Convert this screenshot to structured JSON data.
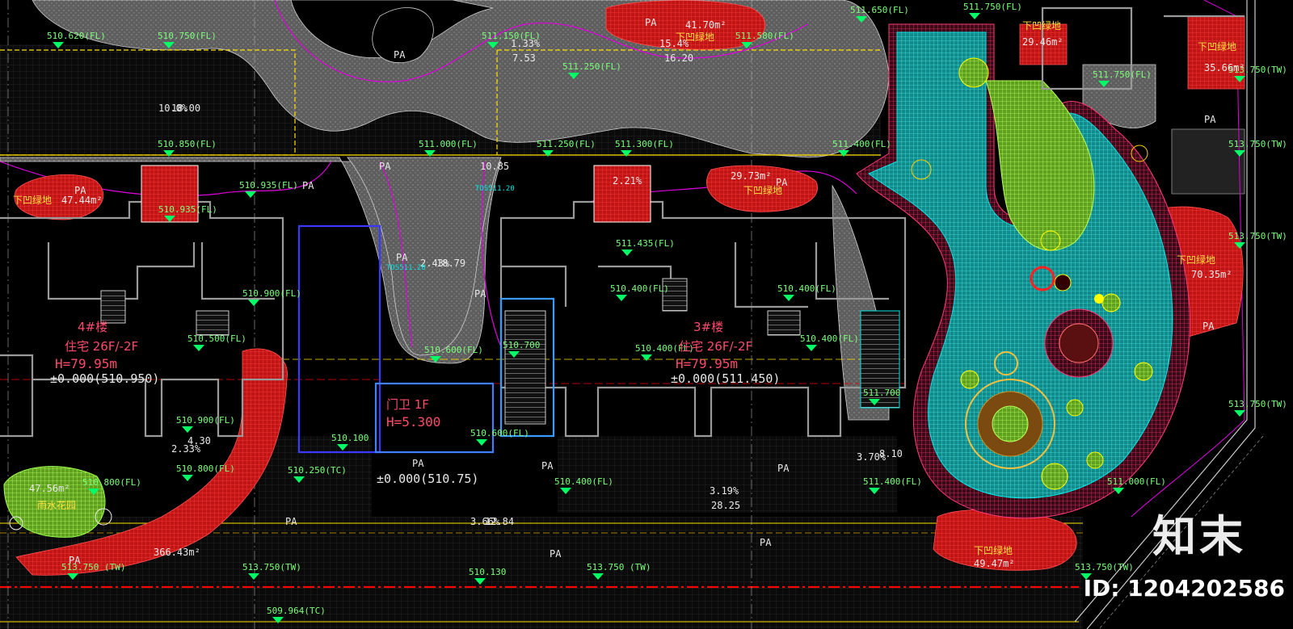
{
  "elevations": [
    "510.620(FL)",
    "510.750(FL)",
    "511.150(FL)",
    "511.250(FL)",
    "511.580(FL)",
    "511.650(FL)",
    "511.750(FL)",
    "511.750(FL)",
    "510.850(FL)",
    "511.000(FL)",
    "511.250(FL)",
    "511.300(FL)",
    "511.400(FL)",
    "510.935(FL)",
    "510.935(FL)",
    "511.435(FL)",
    "510.900(FL)",
    "510.400(FL)",
    "510.400(FL)",
    "510.500(FL)",
    "510.600(FL)",
    "510.700",
    "510.400(FL)",
    "510.400(FL)",
    "511.700",
    "510.900(FL)",
    "510.100",
    "510.800(FL)",
    "510.800(FL)",
    "510.250(TC)",
    "510.600(FL)",
    "510.400(FL)",
    "511.400(FL)",
    "511.000(FL)",
    "513.750(TW)",
    "513.750(TW)",
    "513.750(TW)",
    "513.750(TW)",
    "513.750(TW)",
    "513.750(TW)",
    "513.750 (TW)",
    "513.750 (TW)",
    "510.130",
    "509.964(TC)"
  ],
  "pa_labels": [
    "PA",
    "PA",
    "PA",
    "PA",
    "PA",
    "PA",
    "PA",
    "PA",
    "PA",
    "PA",
    "PA",
    "PA",
    "PA",
    "PA",
    "PA",
    "PA",
    "PA"
  ],
  "areas": [
    {
      "value": "41.70m²",
      "name": "下凹绿地"
    },
    {
      "value": "29.46m²",
      "name": "下凹绿地"
    },
    {
      "value": "35.66m²",
      "name": "下凹绿地"
    },
    {
      "value": "47.44m²",
      "name": "下凹绿地"
    },
    {
      "value": "29.73m²",
      "name": "下凹绿地"
    },
    {
      "value": "70.35m²",
      "name": "下凹绿地"
    },
    {
      "value": "49.47m²",
      "name": "下凹绿地"
    },
    {
      "value": "47.56m²",
      "name": "雨水花园"
    },
    {
      "value": "366.43m²",
      "name": ""
    }
  ],
  "slopes": [
    "1.33%",
    "7.53",
    "15.4%",
    "16.20",
    "2.21%",
    "10.85",
    "3.19%",
    "28.25",
    "2.33%",
    "4.30",
    "3.70%",
    "8.10",
    "3.66%",
    "12.84",
    "2.43%",
    "18.79",
    "10.0%",
    "18.00"
  ],
  "buildings": [
    {
      "name": "4#楼",
      "use": "住宅 26F/-2F",
      "height": "H=79.95m",
      "datum": "±0.000(510.950)"
    },
    {
      "name": "3#楼",
      "use": "住宅 26F/-2F",
      "height": "H=79.95m",
      "datum": "±0.000(511.450)"
    },
    {
      "name": "门卫 1F",
      "use": "",
      "height": "H=5.300",
      "datum": "±0.000(510.75)"
    }
  ],
  "tos_labels": [
    "TOS511.20",
    "TOS511.20"
  ],
  "watermark": {
    "brand": "知末",
    "id": "ID: 1204202586"
  },
  "colors": {
    "bg": "#000000",
    "grass": "#7A7A7A",
    "red": "#D81E1E",
    "cyan": "#1FBFBF",
    "green": "#8BDF3A",
    "magenta": "#E000E0",
    "yellow": "#FFE000",
    "marker": "#00FF66"
  }
}
